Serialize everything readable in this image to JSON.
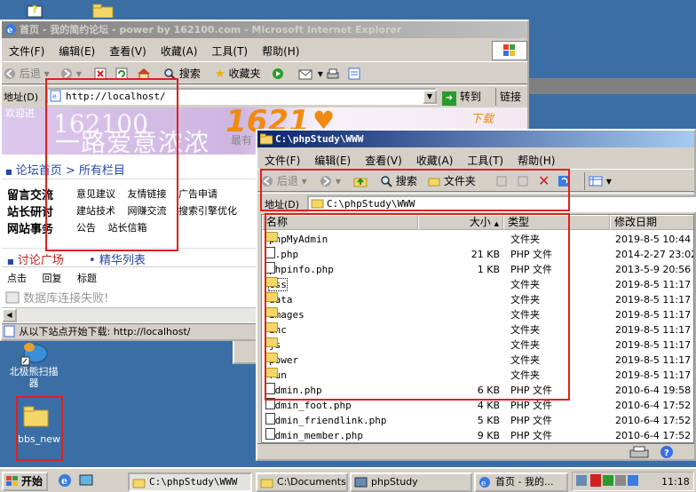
{
  "ie": {
    "title": "首页 - 我的简约论坛 - power by 162100.com - Microsoft Internet Explorer",
    "menu": [
      "文件(F)",
      "编辑(E)",
      "查看(V)",
      "收藏(A)",
      "工具(T)",
      "帮助(H)"
    ],
    "toolbar": {
      "back": "后退",
      "search": "搜索",
      "favorites": "收藏夹"
    },
    "address_label": "地址(D)",
    "address_value": "http://localhost/",
    "go_label": "转到",
    "links_label": "链接",
    "status_text": "从以下站点开始下载: http://localhost/",
    "page": {
      "logo_text": "162100",
      "slogan": "一路爱意浓浓",
      "banner_text": "1621",
      "banner_small": "最有",
      "download_text": "下载",
      "partial_top": "欢迎进",
      "breadcrumb_home": "论坛首页",
      "breadcrumb_sep": ">",
      "breadcrumb_all": "所有栏目",
      "categories": [
        {
          "name": "留言交流",
          "items": [
            "意见建议",
            "友情链接",
            "广告申请"
          ]
        },
        {
          "name": "站长研讨",
          "items": [
            "建站技术",
            "网赚交流",
            "搜索引擎优化"
          ]
        },
        {
          "name": "网站事务",
          "items": [
            "公告",
            "站长信箱"
          ]
        }
      ],
      "tab_discuss": "讨论广场",
      "tab_best": "精华列表",
      "columns": [
        "点击",
        "回复",
        "标题"
      ],
      "error_text": "数据库连接失败!"
    }
  },
  "explorer": {
    "title": "C:\\phpStudy\\WWW",
    "menu": [
      "文件(F)",
      "编辑(E)",
      "查看(V)",
      "收藏(A)",
      "工具(T)",
      "帮助(H)"
    ],
    "toolbar": {
      "back": "后退",
      "search": "搜索",
      "folders": "文件夹"
    },
    "address_label": "地址(D)",
    "address_value": "C:\\phpStudy\\WWW",
    "headers": {
      "name": "名称",
      "size": "大小",
      "type": "类型",
      "date": "修改日期"
    },
    "files": [
      {
        "name": "phpMyAdmin",
        "size": "",
        "type": "文件夹",
        "date": "2019-8-5 10:44",
        "icon": "folder"
      },
      {
        "name": "l.php",
        "size": "21 KB",
        "type": "PHP 文件",
        "date": "2014-2-27 23:02",
        "icon": "php"
      },
      {
        "name": "phpinfo.php",
        "size": "1 KB",
        "type": "PHP 文件",
        "date": "2013-5-9 20:56",
        "icon": "php"
      },
      {
        "name": "css",
        "size": "",
        "type": "文件夹",
        "date": "2019-8-5 11:17",
        "icon": "folder"
      },
      {
        "name": "data",
        "size": "",
        "type": "文件夹",
        "date": "2019-8-5 11:17",
        "icon": "folder"
      },
      {
        "name": "images",
        "size": "",
        "type": "文件夹",
        "date": "2019-8-5 11:17",
        "icon": "folder"
      },
      {
        "name": "inc",
        "size": "",
        "type": "文件夹",
        "date": "2019-8-5 11:17",
        "icon": "folder"
      },
      {
        "name": "js",
        "size": "",
        "type": "文件夹",
        "date": "2019-8-5 11:17",
        "icon": "folder"
      },
      {
        "name": "power",
        "size": "",
        "type": "文件夹",
        "date": "2019-8-5 11:17",
        "icon": "folder"
      },
      {
        "name": "run",
        "size": "",
        "type": "文件夹",
        "date": "2019-8-5 11:17",
        "icon": "folder"
      },
      {
        "name": "admin.php",
        "size": "6 KB",
        "type": "PHP 文件",
        "date": "2010-6-4 19:58",
        "icon": "php"
      },
      {
        "name": "admin_foot.php",
        "size": "4 KB",
        "type": "PHP 文件",
        "date": "2010-6-4 17:52",
        "icon": "php"
      },
      {
        "name": "admin_friendlink.php",
        "size": "5 KB",
        "type": "PHP 文件",
        "date": "2010-6-4 17:52",
        "icon": "php"
      },
      {
        "name": "admin_member.php",
        "size": "9 KB",
        "type": "PHP 文件",
        "date": "2010-6-4 17:52",
        "icon": "php"
      }
    ]
  },
  "desktop": {
    "icons": [
      {
        "label": "北极熊扫描器"
      },
      {
        "label": "bbs_new"
      }
    ]
  },
  "taskbar": {
    "start_label": "开始",
    "tasks": [
      "C:\\phpStudy\\WWW",
      "C:\\Documents...",
      "phpStudy",
      "首页 - 我的..."
    ],
    "clock": "11:18"
  },
  "colors": {
    "desktop": "#3a6ea5",
    "title_active": "#0a246a",
    "highlight": "#e0201c"
  }
}
